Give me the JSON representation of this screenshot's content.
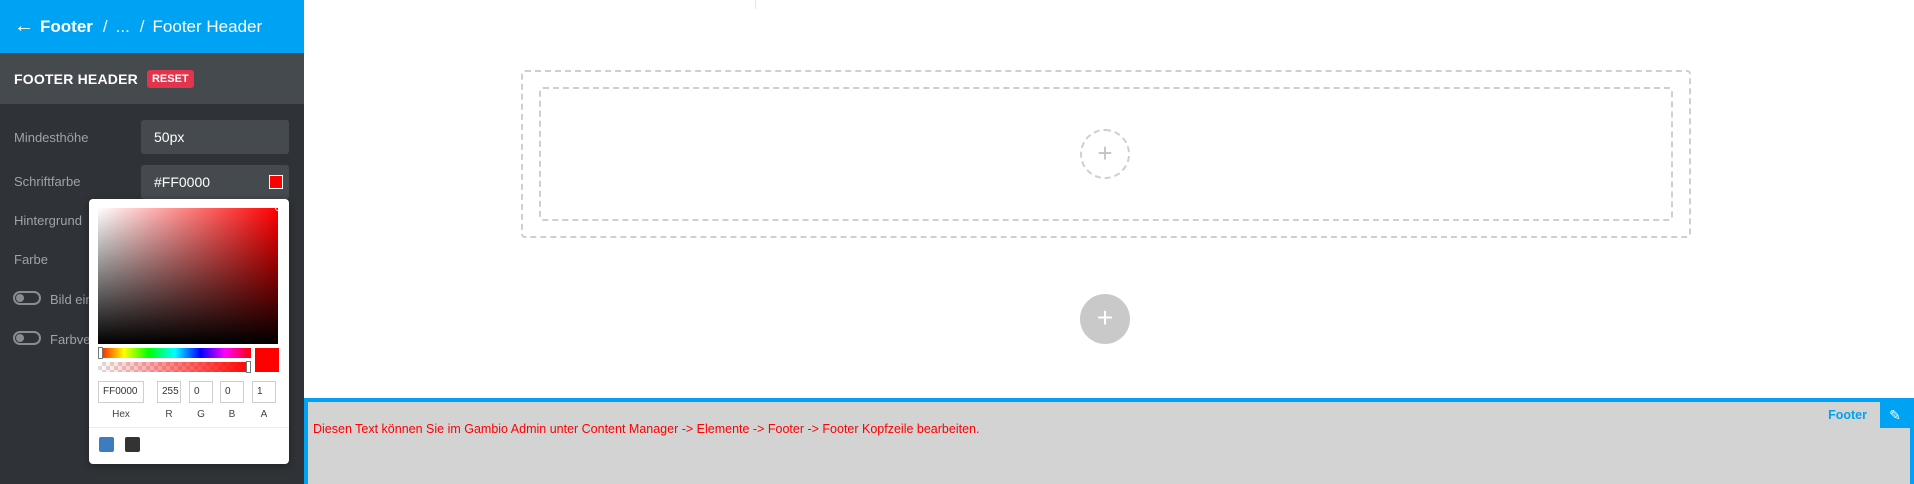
{
  "header": {
    "back_icon": "arrow-left-icon",
    "crumb_main": "Footer",
    "separator": "/",
    "crumb_ellipsis": "...",
    "crumb_current": "Footer Header"
  },
  "section": {
    "title": "FOOTER HEADER",
    "reset_label": "RESET"
  },
  "fields": {
    "min_height_label": "Mindesthöhe",
    "min_height_value": "50px",
    "font_color_label": "Schriftfarbe",
    "font_color_value": "#FF0000",
    "background_label": "Hintergrund",
    "color_label": "Farbe",
    "toggle_image_label": "Bild ein",
    "toggle_gradient_label": "Farbve"
  },
  "picker": {
    "hex_value": "FF0000",
    "r_value": "255",
    "g_value": "0",
    "b_value": "0",
    "a_value": "1",
    "hex_label": "Hex",
    "r_label": "R",
    "g_label": "G",
    "b_label": "B",
    "a_label": "A",
    "preset_colors": [
      "#3b7dbf",
      "#333333"
    ]
  },
  "canvas": {
    "add_icon": "plus-icon",
    "footer_text": "Diesen Text können Sie im Gambio Admin unter Content Manager -> Elemente -> Footer -> Footer Kopfzeile bearbeiten.",
    "footer_tag": "Footer",
    "edit_icon": "pencil-icon"
  },
  "colors": {
    "accent": "#00a3f4",
    "sidebar_bg": "#2f3337",
    "reset_badge": "#e3344e",
    "selected_color": "#ff0000"
  }
}
